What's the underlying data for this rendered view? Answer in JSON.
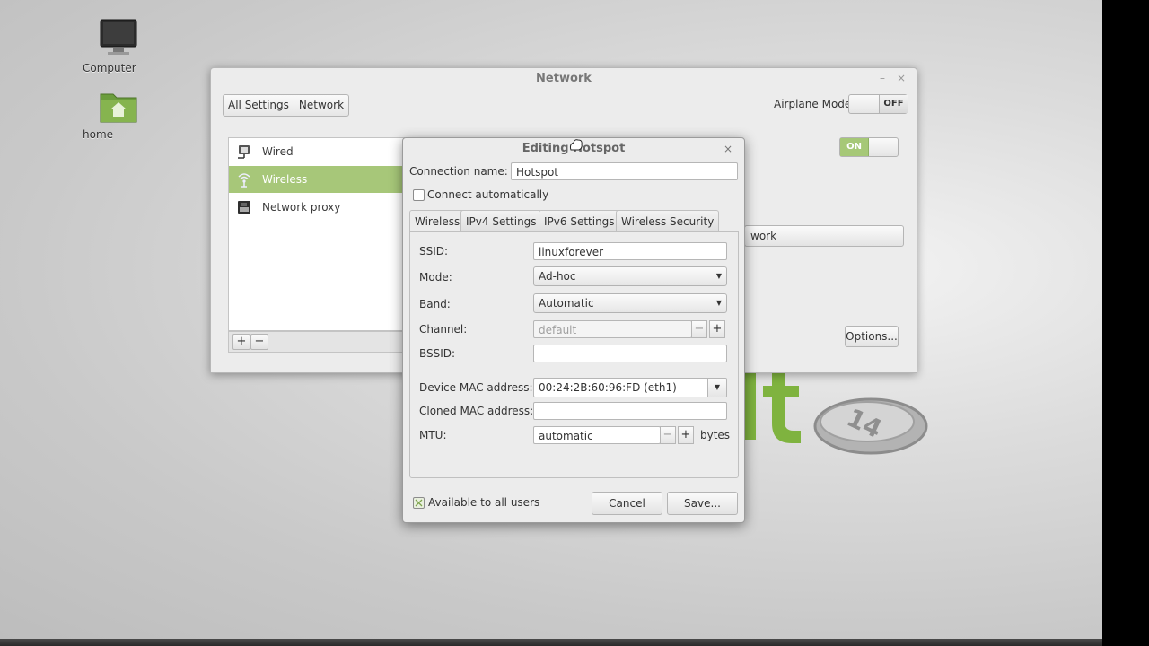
{
  "desktop": {
    "icons": [
      {
        "label": "Computer"
      },
      {
        "label": "home"
      }
    ]
  },
  "network_window": {
    "title": "Network",
    "breadcrumbs": [
      "All Settings",
      "Network"
    ],
    "airplane_mode_label": "Airplane Mode",
    "airplane_switch_state": "OFF",
    "wireless_switch_state": "ON",
    "devices": [
      {
        "label": "Wired",
        "icon": "wired-icon"
      },
      {
        "label": "Wireless",
        "icon": "wireless-icon"
      },
      {
        "label": "Network proxy",
        "icon": "proxy-icon"
      }
    ],
    "add_label": "+",
    "remove_label": "−",
    "partial_button_label": "work",
    "options_button_label": "Options..."
  },
  "edit_dialog": {
    "title": "Editing Hotspot",
    "close_label": "×",
    "connection_name_label": "Connection name:",
    "connection_name_value": "Hotspot",
    "connect_auto_label": "Connect automatically",
    "tabs": [
      "Wireless",
      "IPv4 Settings",
      "IPv6 Settings",
      "Wireless Security"
    ],
    "ssid_label": "SSID:",
    "ssid_value": "linuxforever",
    "mode_label": "Mode:",
    "mode_value": "Ad-hoc",
    "band_label": "Band:",
    "band_value": "Automatic",
    "channel_label": "Channel:",
    "channel_value": "default",
    "bssid_label": "BSSID:",
    "bssid_value": "",
    "device_mac_label": "Device MAC address:",
    "device_mac_value": "00:24:2B:60:96:FD (eth1)",
    "cloned_mac_label": "Cloned MAC address:",
    "cloned_mac_value": "",
    "mtu_label": "MTU:",
    "mtu_value": "automatic",
    "mtu_unit": "bytes",
    "available_all_users_label": "Available to all users",
    "cancel_label": "Cancel",
    "save_label": "Save..."
  },
  "colors": {
    "accent_green": "#a7c779",
    "switch_on": "#a6c877"
  }
}
